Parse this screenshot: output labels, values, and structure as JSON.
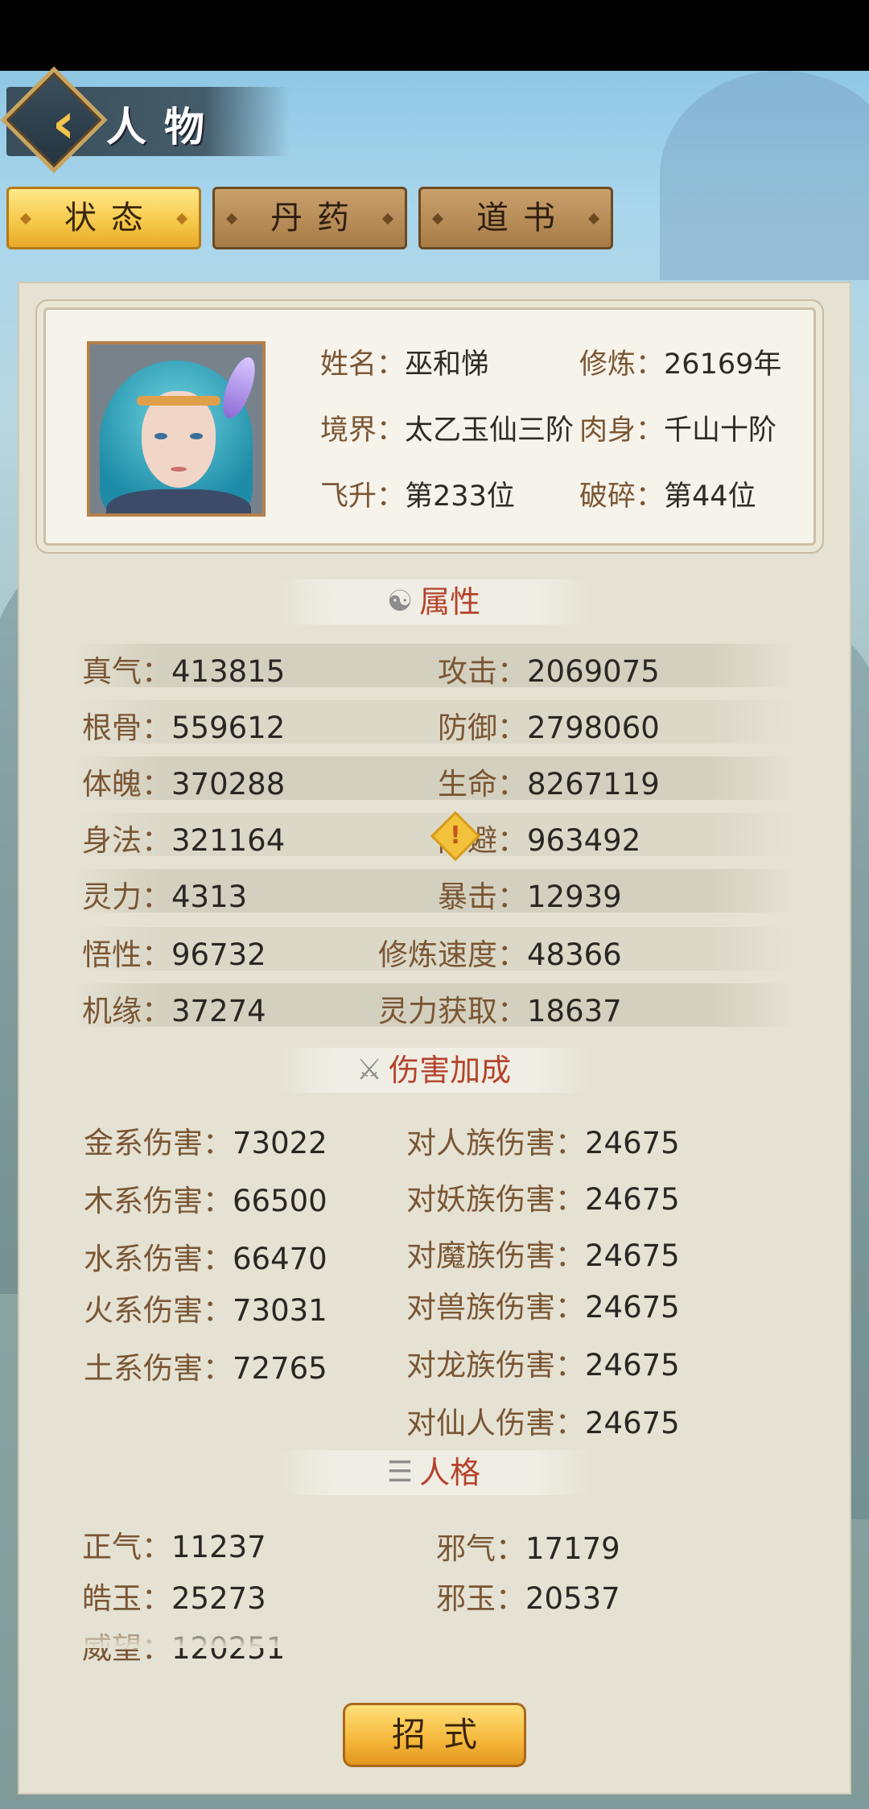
{
  "header": {
    "title": "人物",
    "back_icon": "chevron-left-icon"
  },
  "tabs": [
    {
      "label": "状态",
      "active": true
    },
    {
      "label": "丹药",
      "active": false
    },
    {
      "label": "道书",
      "active": false
    }
  ],
  "profile": {
    "name_label": "姓名",
    "name_value": "巫和悌",
    "cultivate_label": "修炼",
    "cultivate_value": "26169年",
    "realm_label": "境界",
    "realm_value": "太乙玉仙三阶",
    "body_label": "肉身",
    "body_value": "千山十阶",
    "ascend_label": "飞升",
    "ascend_value": "第233位",
    "shatter_label": "破碎",
    "shatter_value": "第44位"
  },
  "attributes": {
    "title": "属性",
    "icon": "yin-yang-icon",
    "left": [
      {
        "label": "真气",
        "value": "413815"
      },
      {
        "label": "根骨",
        "value": "559612"
      },
      {
        "label": "体魄",
        "value": "370288"
      },
      {
        "label": "身法",
        "value": "321164"
      },
      {
        "label": "灵力",
        "value": "4313"
      },
      {
        "label": "悟性",
        "value": "96732"
      },
      {
        "label": "机缘",
        "value": "37274"
      }
    ],
    "right": [
      {
        "label": "攻击",
        "value": "2069075"
      },
      {
        "label": "防御",
        "value": "2798060"
      },
      {
        "label": "生命",
        "value": "8267119"
      },
      {
        "label": "闪避",
        "value": "963492"
      },
      {
        "label": "暴击",
        "value": "12939"
      },
      {
        "label": "修炼速度",
        "value": "48366"
      },
      {
        "label": "灵力获取",
        "value": "18637"
      }
    ]
  },
  "damage": {
    "title": "伤害加成",
    "icon": "crossed-swords-icon",
    "left": [
      {
        "label": "金系伤害",
        "value": "73022"
      },
      {
        "label": "木系伤害",
        "value": "66500"
      },
      {
        "label": "水系伤害",
        "value": "66470"
      },
      {
        "label": "火系伤害",
        "value": "73031"
      },
      {
        "label": "土系伤害",
        "value": "72765"
      }
    ],
    "right": [
      {
        "label": "对人族伤害",
        "value": "24675"
      },
      {
        "label": "对妖族伤害",
        "value": "24675"
      },
      {
        "label": "对魔族伤害",
        "value": "24675"
      },
      {
        "label": "对兽族伤害",
        "value": "24675"
      },
      {
        "label": "对龙族伤害",
        "value": "24675"
      },
      {
        "label": "对仙人伤害",
        "value": "24675"
      }
    ]
  },
  "personality": {
    "title": "人格",
    "icon": "scroll-icon",
    "left": [
      {
        "label": "正气",
        "value": "11237"
      },
      {
        "label": "皓玉",
        "value": "25273"
      },
      {
        "label": "威望",
        "value": "120251"
      }
    ],
    "right": [
      {
        "label": "邪气",
        "value": "17179"
      },
      {
        "label": "邪玉",
        "value": "20537"
      }
    ]
  },
  "sep": "：",
  "footer": {
    "skill_button": "招式"
  },
  "colors": {
    "accent_red": "#b4432c",
    "gold": "#f5c646",
    "label_brown": "#7a5634"
  }
}
